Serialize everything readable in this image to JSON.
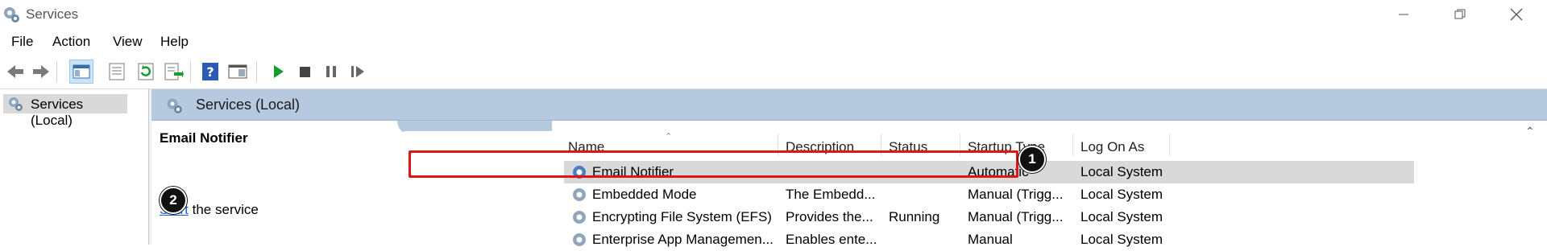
{
  "window": {
    "title": "Services"
  },
  "menu": [
    "File",
    "Action",
    "View",
    "Help"
  ],
  "toolbar": {
    "icons": [
      "back-icon",
      "forward-icon",
      "show-console-tree-icon",
      "properties-icon",
      "refresh-icon",
      "export-list-icon",
      "help-icon",
      "show-action-pane-icon",
      "start-service-icon",
      "stop-service-icon",
      "pause-service-icon",
      "resume-service-icon"
    ],
    "accent": "#1a9b2e"
  },
  "tree": {
    "item": "Services (Local)"
  },
  "panel": {
    "header": "Services (Local)",
    "selected_service": "Email Notifier",
    "action_link": "Start",
    "action_rest": " the service"
  },
  "columns": [
    "Name",
    "Description",
    "Status",
    "Startup Type",
    "Log On As"
  ],
  "rows": [
    {
      "name": "Email Notifier",
      "description": "",
      "status": "",
      "startup": "Automatic",
      "logon": "Local System"
    },
    {
      "name": "Embedded Mode",
      "description": "The Embedd...",
      "status": "",
      "startup": "Manual (Trigg...",
      "logon": "Local System"
    },
    {
      "name": "Encrypting File System (EFS)",
      "description": "Provides the...",
      "status": "Running",
      "startup": "Manual (Trigg...",
      "logon": "Local System"
    },
    {
      "name": "Enterprise App Managemen...",
      "description": "Enables ente...",
      "status": "",
      "startup": "Manual",
      "logon": "Local System"
    }
  ],
  "callouts": [
    "1",
    "2"
  ],
  "colors": {
    "header": "#b6c9df",
    "highlight": "#e01616",
    "link": "#1a5bd6",
    "selected_row": "#d9d9d9"
  }
}
